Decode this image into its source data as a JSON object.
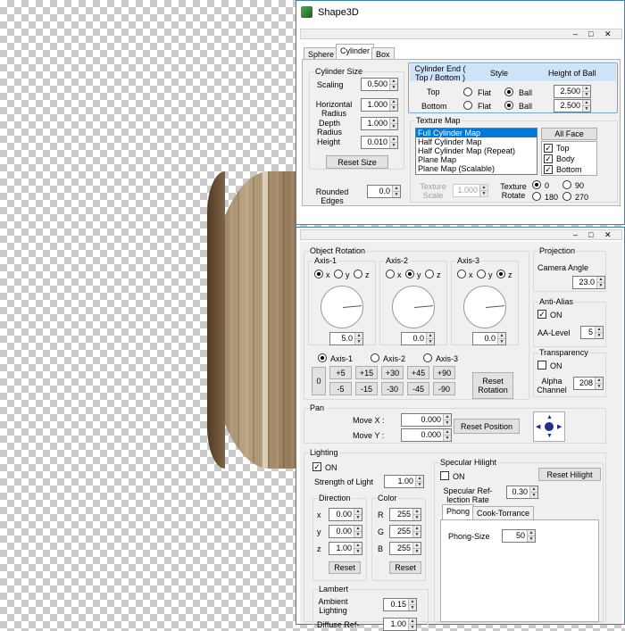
{
  "window": {
    "title": "Shape3D",
    "controls": [
      "–",
      "□",
      "✕"
    ]
  },
  "tabs": [
    "Sphere",
    "Cylinder",
    "Box"
  ],
  "cylinder_size": {
    "title": "Cylinder Size",
    "scaling_label": "Scaling",
    "scaling": "0.500",
    "hradius_label": "Horizontal Radius",
    "hradius": "1.000",
    "dradius_label": "Depth Radius",
    "dradius": "1.000",
    "height_label": "Height",
    "height": "0.010",
    "reset": "Reset Size"
  },
  "rounded": {
    "label": "Rounded Edges",
    "value": "0.0"
  },
  "cyl_end": {
    "header": "Cylinder End ( Top / Bottom )",
    "style": "Style",
    "hob": "Height of Ball",
    "top": "Top",
    "bottom": "Bottom",
    "flat": "Flat",
    "ball": "Ball",
    "top_value": "2.500",
    "bottom_value": "2.500"
  },
  "texture_map": {
    "title": "Texture Map",
    "items": [
      "Full Cylinder Map",
      "Half Cylinder Map",
      "Half Cylinder Map (Repeat)",
      "Plane Map",
      "Plane Map (Scalable)"
    ],
    "all_face": "All Face",
    "top": "Top",
    "body": "Body",
    "bottom": "Bottom",
    "scale_label": "Texture Scale",
    "scale": "1.000",
    "rotate_label": "Texture Rotate",
    "r0": "0",
    "r90": "90",
    "r180": "180",
    "r270": "270"
  },
  "rotation": {
    "title": "Object Rotation",
    "axis1": "Axis-1",
    "axis2": "Axis-2",
    "axis3": "Axis-3",
    "x": "x",
    "y": "y",
    "z": "z",
    "v1": "5.0",
    "v2": "0.0",
    "v3": "0.0",
    "zero": "0",
    "plus": [
      "+5",
      "+15",
      "+30",
      "+45",
      "+90"
    ],
    "minus": [
      "-5",
      "-15",
      "-30",
      "-45",
      "-90"
    ],
    "reset": "Reset Rotation"
  },
  "projection": {
    "title": "Projection",
    "label": "Camera Angle",
    "value": "23.0"
  },
  "antialias": {
    "title": "Anti-Alias",
    "on": "ON",
    "level_label": "AA-Level",
    "level": "5"
  },
  "transparency": {
    "title": "Transparency",
    "on": "ON",
    "alpha_label": "Alpha Channel",
    "alpha": "208"
  },
  "pan": {
    "title": "Pan",
    "mx_label": "Move X :",
    "mx": "0.000",
    "my_label": "Move Y :",
    "my": "0.000",
    "reset": "Reset Position"
  },
  "lighting": {
    "title": "Lighting",
    "on": "ON",
    "strength_label": "Strength of Light",
    "strength": "1.00",
    "direction": "Direction",
    "x": "x",
    "y": "y",
    "z": "z",
    "dx": "0.00",
    "dy": "0.00",
    "dz": "1.00",
    "dir_reset": "Reset",
    "color": "Color",
    "r": "R",
    "g": "G",
    "b": "B",
    "cr": "255",
    "cg": "255",
    "cb": "255",
    "color_reset": "Reset"
  },
  "lambert": {
    "title": "Lambert",
    "ambient_label": "Ambient Lighting",
    "ambient": "0.15",
    "diffuse_label": "Diffuse Ref-",
    "diffuse": "1.00"
  },
  "specular": {
    "title": "Specular Hilight",
    "on": "ON",
    "reset": "Reset Hilight",
    "rate_label": "Specular Ref-lection Rate",
    "rate": "0.30",
    "tab_phong": "Phong",
    "tab_cook": "Cook-Torrance",
    "size_label": "Phong-Size",
    "size": "50"
  }
}
